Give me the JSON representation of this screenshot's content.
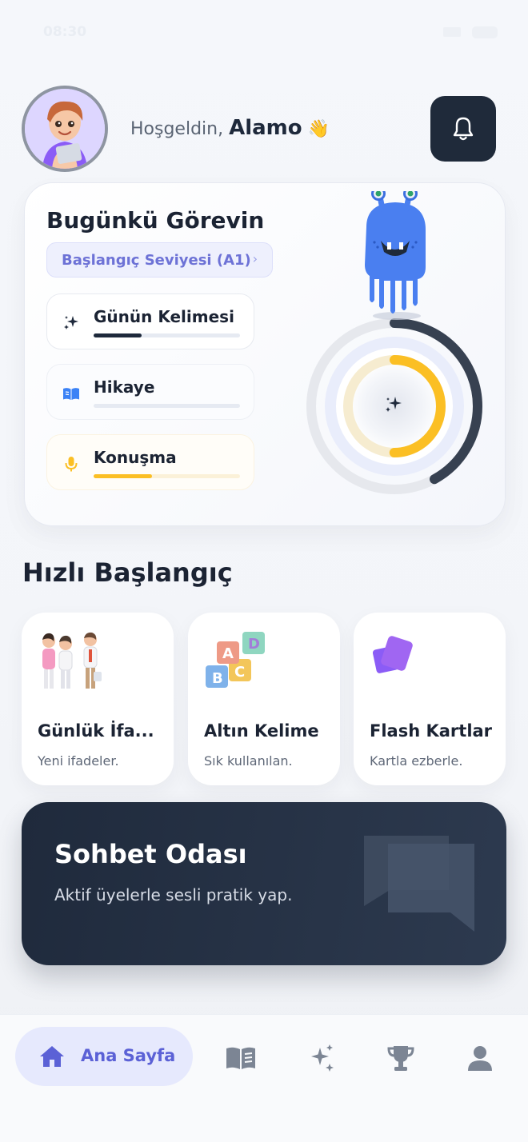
{
  "status_bar": {
    "time": "08:30"
  },
  "header": {
    "greeting_prefix": "Hoşgeldin,",
    "user_name": "Alamo",
    "wave_emoji": "👋"
  },
  "daily_task": {
    "title": "Bugünkü Görevin",
    "level_label": "Başlangıç Seviyesi (A1)",
    "level_chevron": "›",
    "items": [
      {
        "label": "Günün Kelimesi",
        "icon": "sparkles-icon",
        "progress": 0.33,
        "color": "#1e293b"
      },
      {
        "label": "Hikaye",
        "icon": "book-icon",
        "progress": 0.0,
        "color": "#3b82f6"
      },
      {
        "label": "Konuşma",
        "icon": "microphone-icon",
        "progress": 0.4,
        "color": "#fbbf24"
      }
    ],
    "ring": {
      "outer_progress": 0.42,
      "inner_progress": 0.5
    }
  },
  "quick_start": {
    "title": "Hızlı Başlangıç",
    "cards": [
      {
        "title": "Günlük İfa...",
        "subtitle": "Yeni ifadeler.",
        "icon": "people-talking-icon"
      },
      {
        "title": "Altın Kelime",
        "subtitle": "Sık kullanılan.",
        "icon": "abc-blocks-icon"
      },
      {
        "title": "Flash Kartlar",
        "subtitle": "Kartla ezberle.",
        "icon": "flash-cards-icon"
      }
    ]
  },
  "chat_room": {
    "title": "Sohbet Odası",
    "subtitle": "Aktif üyelerle sesli pratik yap."
  },
  "bottom_nav": {
    "home_label": "Ana Sayfa",
    "items": [
      "home-icon",
      "book-icon",
      "sparkles-icon",
      "trophy-icon",
      "user-icon"
    ]
  },
  "colors": {
    "accent": "#5b61d6",
    "dark": "#1f2a3a",
    "yellow": "#fbbf24",
    "blue": "#3b82f6"
  }
}
